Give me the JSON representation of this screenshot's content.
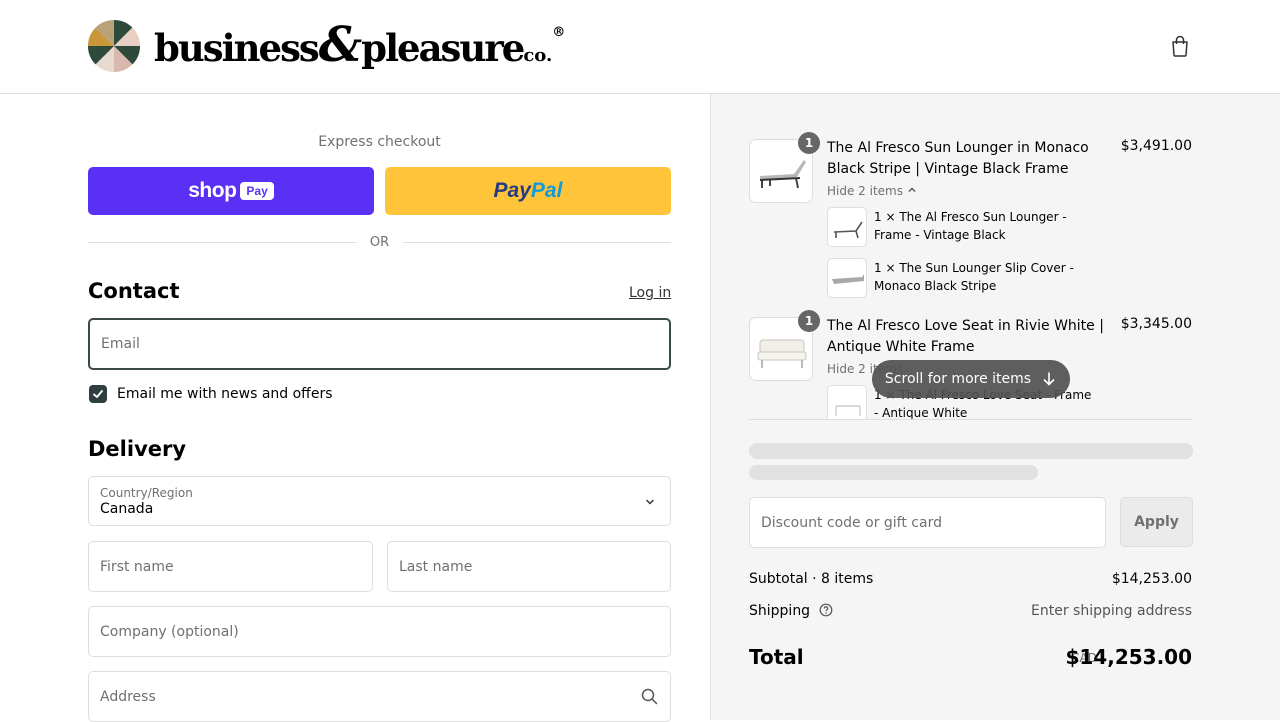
{
  "header": {
    "brand_main": "business",
    "brand_amp": "&",
    "brand_second": "pleasure",
    "brand_co": "co.",
    "brand_reg": "®",
    "cart_icon": "shopping-bag-icon"
  },
  "express": {
    "title": "Express checkout",
    "shop_label": "shop",
    "shop_pay_badge": "Pay",
    "paypal_part1": "Pay",
    "paypal_part2": "Pal",
    "or_label": "OR"
  },
  "contact": {
    "title": "Contact",
    "login_label": "Log in",
    "email_placeholder": "Email",
    "newsletter_label": "Email me with news and offers",
    "newsletter_checked": true
  },
  "delivery": {
    "title": "Delivery",
    "country_label": "Country/Region",
    "country_value": "Canada",
    "first_name_placeholder": "First name",
    "last_name_placeholder": "Last name",
    "company_placeholder": "Company (optional)",
    "address_placeholder": "Address"
  },
  "order": {
    "products": [
      {
        "qty": "1",
        "name": "The Al Fresco Sun Lounger in Monaco Black Stripe | Vintage Black Frame",
        "price": "$3,491.00",
        "hide_label": "Hide 2 items",
        "sub_items": [
          {
            "label": "1 × The Al Fresco Sun Lounger - Frame - Vintage Black"
          },
          {
            "label": "1 × The Sun Lounger Slip Cover - Monaco Black Stripe"
          }
        ]
      },
      {
        "qty": "1",
        "name": "The Al Fresco Love Seat in Rivie White | Antique White Frame",
        "price": "$3,345.00",
        "hide_label": "Hide 2 items",
        "sub_items": [
          {
            "label": "1 × The Al Fresco Love Seat - Frame - Antique White"
          }
        ]
      }
    ],
    "scroll_hint": "Scroll for more items",
    "discount_placeholder": "Discount code or gift card",
    "apply_label": "Apply",
    "subtotal_label": "Subtotal · 8 items",
    "subtotal_value": "$14,253.00",
    "shipping_label": "Shipping",
    "shipping_value": "Enter shipping address",
    "total_label": "Total",
    "currency": "CAD",
    "total_value": "$14,253.00"
  },
  "colors": {
    "shop_pay": "#5a31f4",
    "paypal": "#ffc439",
    "checkbox": "#2f3f3f",
    "summary_bg": "#f5f5f5"
  }
}
